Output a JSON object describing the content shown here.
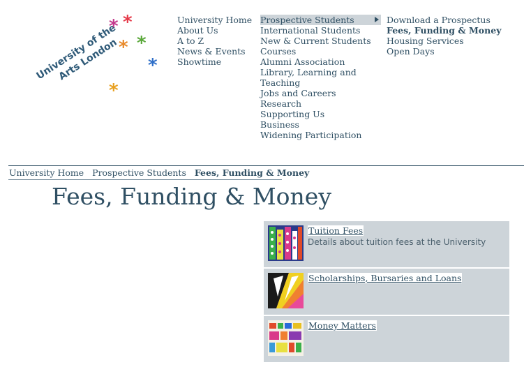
{
  "logo": {
    "text_line1": "University of the",
    "text_line2": "Arts London"
  },
  "nav_primary": [
    "University Home",
    "About Us",
    "A to Z",
    "News & Events",
    "Showtime"
  ],
  "nav_secondary": [
    "Prospective Students",
    "International Students",
    "New & Current Students",
    "Courses",
    "Alumni Association",
    "Library, Learning and",
    "Teaching",
    "Jobs and Careers",
    "Research",
    "Supporting Us",
    "Business",
    "Widening Participation"
  ],
  "nav_tertiary": [
    "Download a Prospectus",
    "Fees, Funding & Money",
    "Housing Services",
    "Open Days"
  ],
  "breadcrumb": {
    "home": "University Home",
    "section": "Prospective Students",
    "current": "Fees, Funding & Money"
  },
  "page_title": "Fees, Funding & Money",
  "cards": [
    {
      "title": "Tuition Fees",
      "description": "Details about tuition fees at the University"
    },
    {
      "title": "Scholarships, Bursaries and Loans",
      "description": ""
    },
    {
      "title": "Money Matters",
      "description": ""
    }
  ],
  "colors": {
    "text": "#2f4f63",
    "panel": "#cdd4d9",
    "active_nav": "#cdd4d9"
  }
}
